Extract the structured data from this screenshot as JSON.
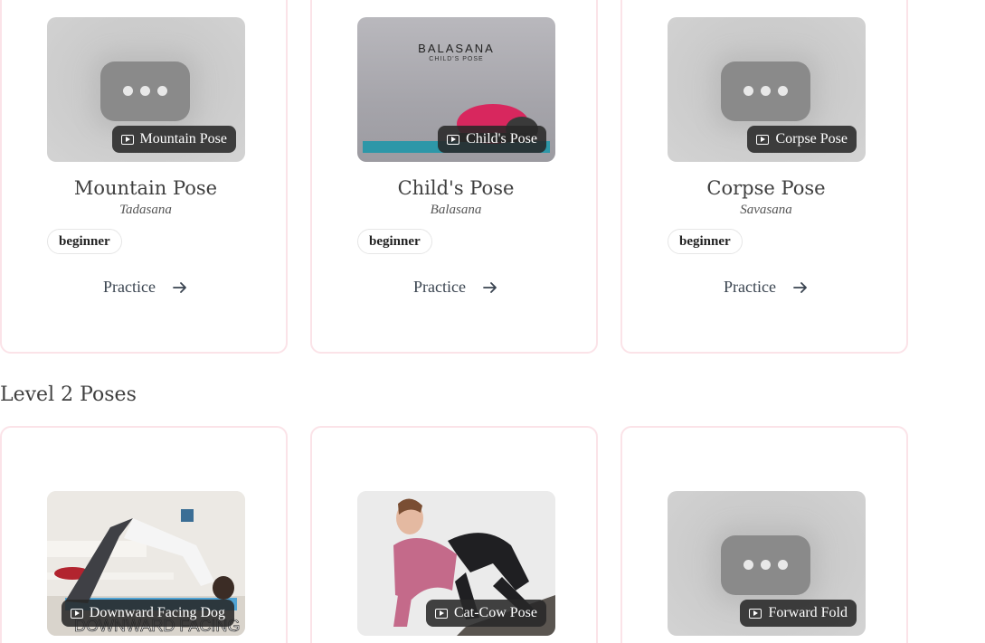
{
  "level1": {
    "cards": [
      {
        "video_label": "Mountain Pose",
        "name": "Mountain Pose",
        "sanskrit": "Tadasana",
        "level": "beginner",
        "action": "Practice",
        "thumb": "placeholder"
      },
      {
        "video_label": "Child's Pose",
        "name": "Child's Pose",
        "sanskrit": "Balasana",
        "level": "beginner",
        "action": "Practice",
        "thumb": "image",
        "thumb_text": "BALASANA",
        "thumb_subtext": "CHILD'S POSE"
      },
      {
        "video_label": "Corpse Pose",
        "name": "Corpse Pose",
        "sanskrit": "Savasana",
        "level": "beginner",
        "action": "Practice",
        "thumb": "placeholder"
      }
    ]
  },
  "level2": {
    "title": "Level 2 Poses",
    "cards": [
      {
        "video_label": "Downward Facing Dog",
        "thumb": "image",
        "thumb_text": "DOWNWARD FACING DO"
      },
      {
        "video_label": "Cat-Cow Pose",
        "thumb": "image"
      },
      {
        "video_label": "Forward Fold",
        "thumb": "placeholder"
      }
    ]
  },
  "colors": {
    "card_border": "#fbe3e8",
    "badge_bg": "#282828",
    "text": "#3f3f3f"
  }
}
